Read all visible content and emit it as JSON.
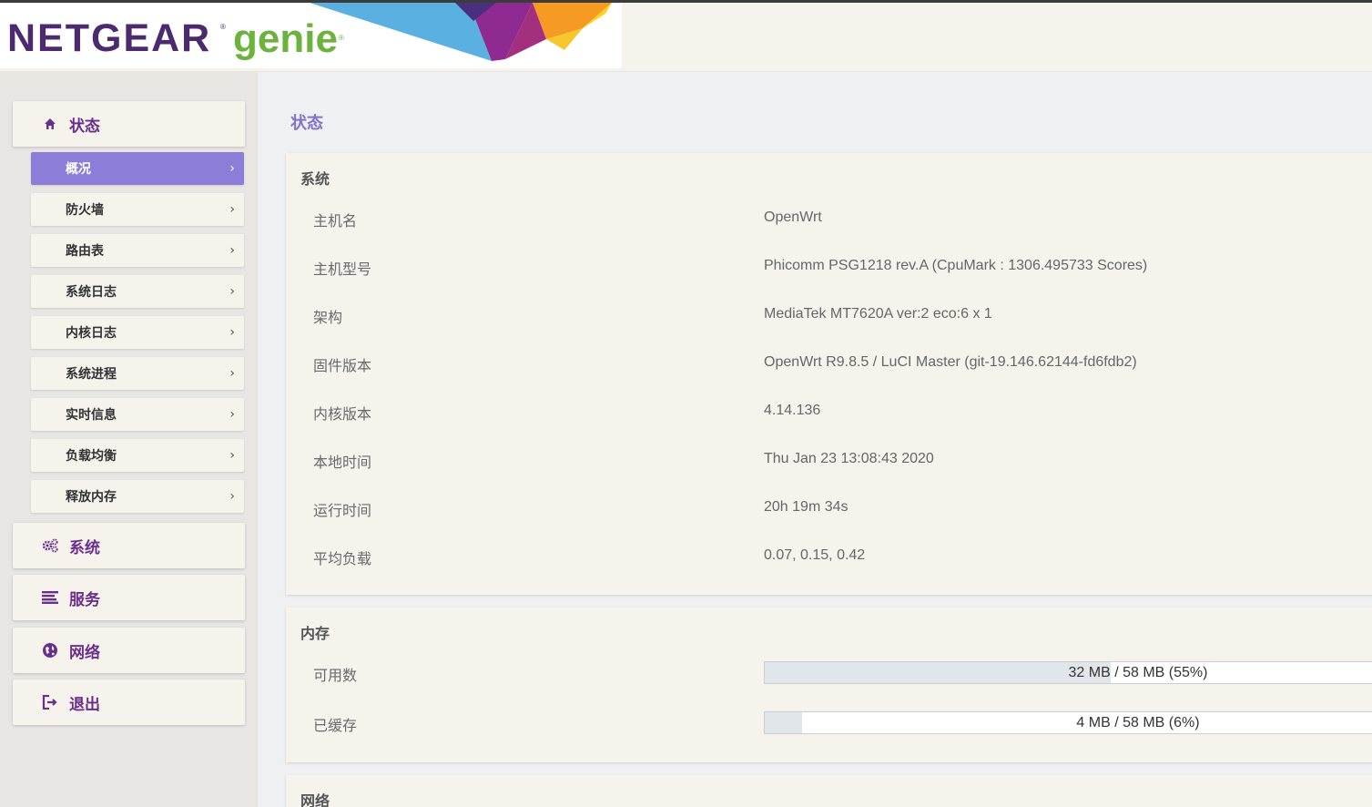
{
  "brand": {
    "name": "NETGEAR",
    "product": "genie",
    "reg_mark": "®"
  },
  "sidebar": {
    "groups": [
      {
        "label": "状态",
        "icon": "home-icon"
      },
      {
        "label": "系统",
        "icon": "gears-icon"
      },
      {
        "label": "服务",
        "icon": "list-icon"
      },
      {
        "label": "网络",
        "icon": "globe-icon"
      },
      {
        "label": "退出",
        "icon": "logout-icon"
      }
    ],
    "status_items": [
      {
        "label": "概况",
        "active": true
      },
      {
        "label": "防火墙"
      },
      {
        "label": "路由表"
      },
      {
        "label": "系统日志"
      },
      {
        "label": "内核日志"
      },
      {
        "label": "系统进程"
      },
      {
        "label": "实时信息"
      },
      {
        "label": "负载均衡"
      },
      {
        "label": "释放内存"
      }
    ],
    "chevron": "›"
  },
  "main": {
    "title": "状态",
    "system": {
      "title": "系统",
      "rows": [
        {
          "label": "主机名",
          "value": "OpenWrt"
        },
        {
          "label": "主机型号",
          "value": "Phicomm PSG1218 rev.A (CpuMark : 1306.495733 Scores)"
        },
        {
          "label": "架构",
          "value": "MediaTek MT7620A ver:2 eco:6 x 1"
        },
        {
          "label": "固件版本",
          "value": "OpenWrt R9.8.5 / LuCI Master (git-19.146.62144-fd6fdb2)"
        },
        {
          "label": "内核版本",
          "value": "4.14.136"
        },
        {
          "label": "本地时间",
          "value": "Thu Jan 23 13:08:43 2020"
        },
        {
          "label": "运行时间",
          "value": "20h 19m 34s"
        },
        {
          "label": "平均负载",
          "value": "0.07, 0.15, 0.42"
        }
      ]
    },
    "memory": {
      "title": "内存",
      "rows": [
        {
          "label": "可用数",
          "value": "32 MB / 58 MB (55%)",
          "percent": 55
        },
        {
          "label": "已缓存",
          "value": "4 MB / 58 MB (6%)",
          "percent": 6
        }
      ]
    },
    "network": {
      "title": "网络"
    }
  },
  "colors": {
    "accent": "#8c7dd9",
    "menu_text": "#6a2f8c",
    "title": "#8272c8",
    "brand_purple": "#4b2a6e",
    "brand_green": "#6cb33e"
  }
}
